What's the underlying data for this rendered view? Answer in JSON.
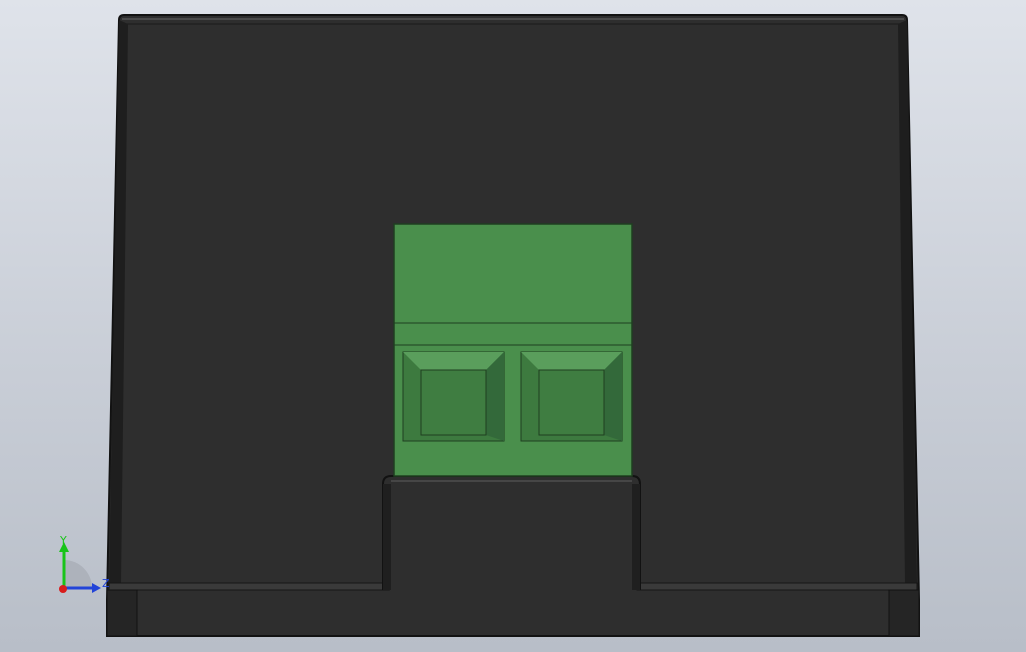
{
  "viewport": {
    "background_top": "#dfe3ea",
    "background_bottom": "#b8bec8"
  },
  "model": {
    "housing_color": "#2e2e2e",
    "housing_edge_color": "#121212",
    "terminal_block_color": "#4a8f4c",
    "terminal_pocket_color": "#3d7a3f",
    "terminal_edge_color": "#1f3f20"
  },
  "axis_triad": {
    "y_label": "Y",
    "z_label": "Z",
    "y_color": "#19c419",
    "z_color": "#2244d8",
    "origin_color": "#d81c1c"
  }
}
